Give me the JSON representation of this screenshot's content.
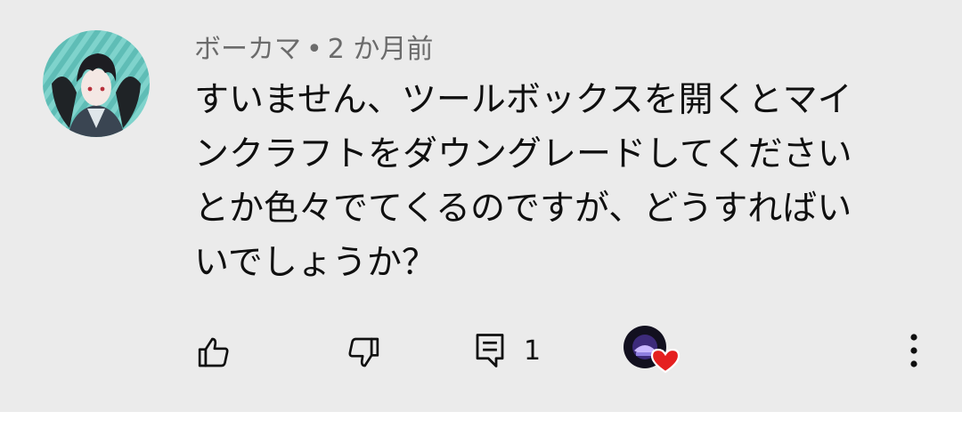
{
  "comment": {
    "author": "ボーカマ",
    "separator": "•",
    "time": "2 か月前",
    "text": "すいません、ツールボックスを開くとマイ\nンクラフトをダウングレードしてください\nとか色々でてくるのですが、どうすればい\nいでしょうか？"
  },
  "actions": {
    "like_icon": "thumb-up-icon",
    "dislike_icon": "thumb-down-icon",
    "reply_icon": "reply-comment-icon",
    "reply_count": "1",
    "creator_heart_icon": "heart-icon",
    "more_icon": "more-vertical-icon"
  },
  "colors": {
    "card_bg": "#ebebeb",
    "meta_text": "#6b6b6b",
    "body_text": "#0f0f0f",
    "heart": "#e52020"
  }
}
